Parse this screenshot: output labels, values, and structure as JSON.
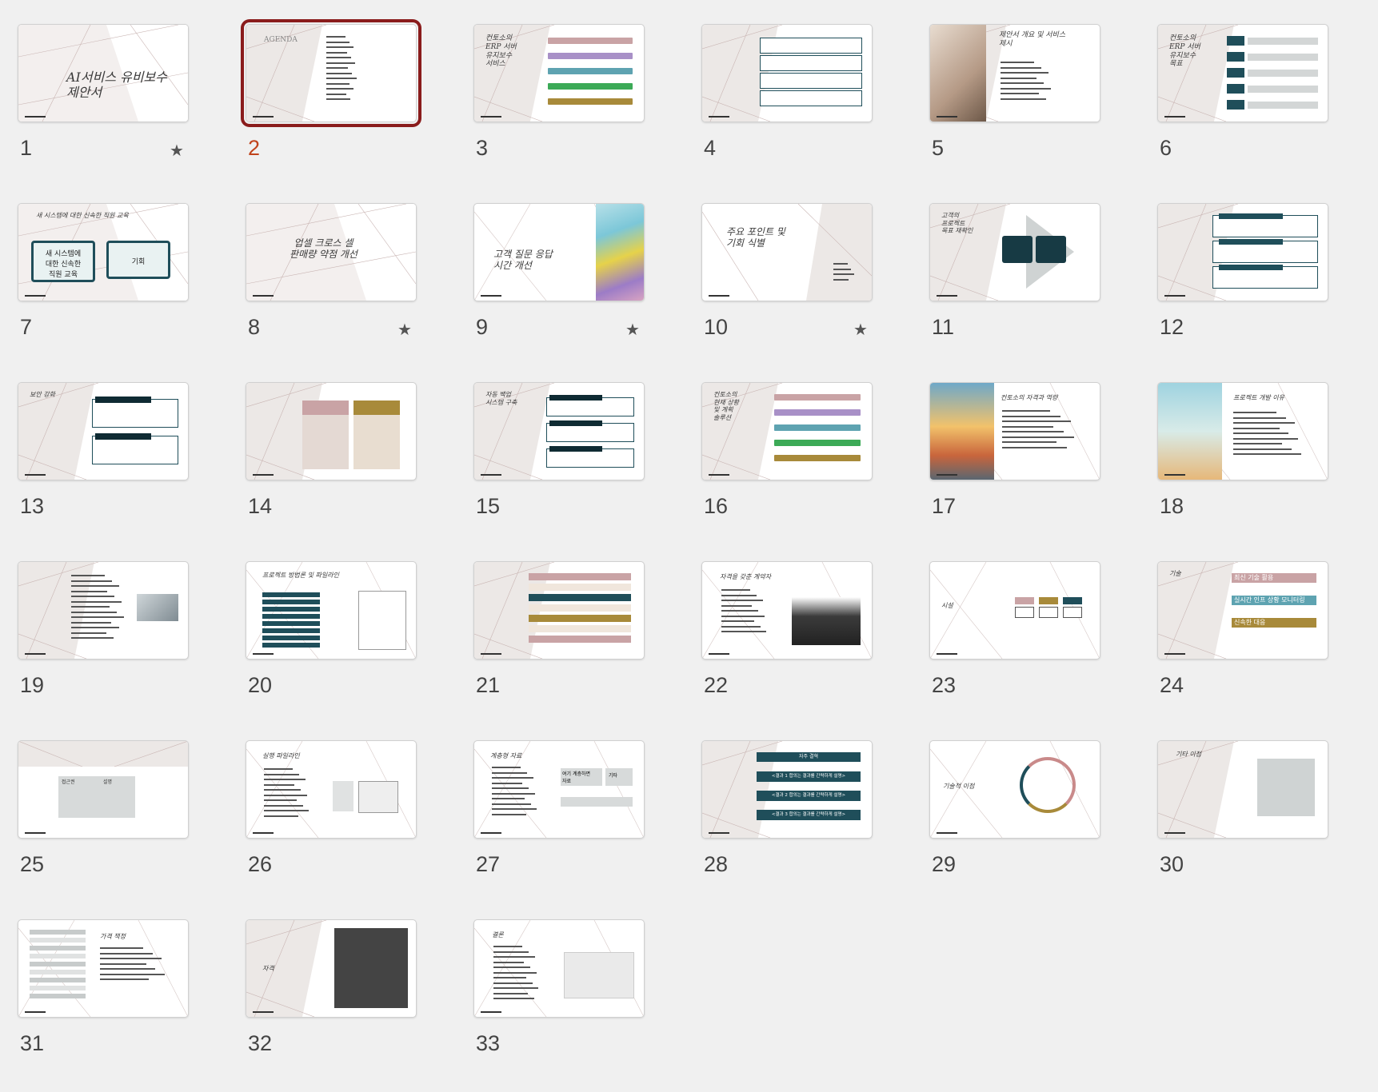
{
  "colors": {
    "background": "#f0f0f0",
    "selected": "#8a1c1c",
    "selected_number": "#c0431b",
    "accent_teal": "#1f4e5a"
  },
  "slides": [
    {
      "n": "1",
      "title": "AI서비스 유비보수\n제안서",
      "star": true
    },
    {
      "n": "2",
      "title": "AGENDA",
      "selected": true
    },
    {
      "n": "3",
      "title": "컨토소의\nERP 서버\n유지보수\n서비스"
    },
    {
      "n": "4",
      "title": ""
    },
    {
      "n": "5",
      "title": "제안서 개요 및 서비스\n제시"
    },
    {
      "n": "6",
      "title": "컨토소의\nERP 서버\n유지보수\n목표"
    },
    {
      "n": "7",
      "title": "새 시스템에 대한 신속한 직원 교육",
      "box1": "새 시스템에\n대한 신속한\n직원 교육",
      "box2": "기회"
    },
    {
      "n": "8",
      "title": "업셀 크로스 셀\n판매량 약점 개선",
      "star": true
    },
    {
      "n": "9",
      "title": "고객 질문 응답\n시간 개선",
      "star": true
    },
    {
      "n": "10",
      "title": "주요 포인트 및\n기회 식별",
      "star": true
    },
    {
      "n": "11",
      "title": "고객의\n프로젝트\n목표 재확인"
    },
    {
      "n": "12",
      "title": ""
    },
    {
      "n": "13",
      "title": "보안 강화"
    },
    {
      "n": "14",
      "title": ""
    },
    {
      "n": "15",
      "title": "자동 백업\n시스템 구축"
    },
    {
      "n": "16",
      "title": "컨토소의\n현재 상황\n및 계획\n솔루션"
    },
    {
      "n": "17",
      "title": "컨토소의 자격과 역량"
    },
    {
      "n": "18",
      "title": "프로젝트 개발 이유"
    },
    {
      "n": "19",
      "title": ""
    },
    {
      "n": "20",
      "title": "프로젝트 방법론 및 파일라인"
    },
    {
      "n": "21",
      "title": ""
    },
    {
      "n": "22",
      "title": "자격을 갖춘 계약자"
    },
    {
      "n": "23",
      "title": "시설"
    },
    {
      "n": "24",
      "title": "기술",
      "bar1": "최신 기술 활용",
      "bar2": "실시간 인프 상황 모니터링",
      "bar3": "신속한 대응"
    },
    {
      "n": "25",
      "title": "",
      "col1": "접근권",
      "col2": "설명"
    },
    {
      "n": "26",
      "title": "실행 파일라인"
    },
    {
      "n": "27",
      "title": "계층형 자료",
      "side1": "여기 계층하면\n자료",
      "side2": "기타"
    },
    {
      "n": "28",
      "title": "",
      "head": "자주 결혁",
      "step1": "<결과 1 합의는 결과를 간략하게 설명>",
      "step2": "<결과 2 합의는 결과를 간략하게 설명>",
      "step3": "<결과 3 합의는 결과를 간략하게 설명>"
    },
    {
      "n": "29",
      "title": "기술적 이점"
    },
    {
      "n": "30",
      "title": "기타 이점"
    },
    {
      "n": "31",
      "title": "가격 책정"
    },
    {
      "n": "32",
      "title": "자격"
    },
    {
      "n": "33",
      "title": "결론"
    }
  ]
}
